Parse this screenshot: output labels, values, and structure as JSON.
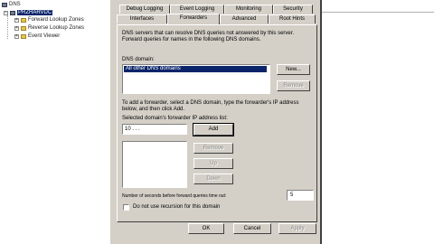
{
  "tree": {
    "root": "DNS",
    "server": "PRZHARVDC",
    "items": [
      "Forward Lookup Zones",
      "Reverse Lookup Zones",
      "Event Viewer"
    ]
  },
  "dialog": {
    "tabs_back": [
      "Debug Logging",
      "Event Logging",
      "Monitoring",
      "Security"
    ],
    "tabs_front": [
      "Interfaces",
      "Forwarders",
      "Advanced",
      "Root Hints"
    ],
    "active_tab": "Forwarders",
    "intro_text": "DNS servers that can resolve DNS queries not answered by this server. Forward queries for names in the following DNS domains.",
    "dns_domain_label": "DNS domain:",
    "dns_domains": [
      "All other DNS domains"
    ],
    "new_button": "New...",
    "remove_button": "Remove",
    "add_forwarder_text": "To add a forwarder, select a DNS domain, type the forwarder's IP address below, and then click Add.",
    "ip_list_label": "Selected domain's forwarder IP address list:",
    "ip_input_value": "10 .  .  .",
    "add_button": "Add",
    "ip_remove_button": "Remove",
    "up_button": "Up",
    "down_button": "Down",
    "timeout_label": "Number of seconds before forward queries time out:",
    "timeout_value": "5",
    "no_recursion_label": "Do not use recursion for this domain",
    "ok_button": "OK",
    "cancel_button": "Cancel",
    "apply_button": "Apply"
  }
}
